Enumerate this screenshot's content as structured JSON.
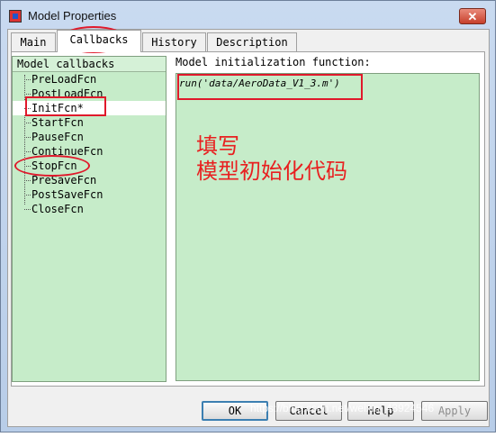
{
  "window": {
    "title": "Model Properties",
    "close_label": "✕"
  },
  "tabs": [
    {
      "label": "Main"
    },
    {
      "label": "Callbacks",
      "active": true
    },
    {
      "label": "History"
    },
    {
      "label": "Description"
    }
  ],
  "callbacks": {
    "header": "Model callbacks",
    "items": [
      "PreLoadFcn",
      "PostLoadFcn",
      "InitFcn*",
      "StartFcn",
      "PauseFcn",
      "ContinueFcn",
      "StopFcn",
      "PreSaveFcn",
      "PostSaveFcn",
      "CloseFcn"
    ],
    "selected": "InitFcn*"
  },
  "editor": {
    "label": "Model initialization function:",
    "code": "run('data/AeroData_V1_3.m')"
  },
  "annotation": {
    "line1": "填写",
    "line2": "模型初始化代码",
    "color": "#e82020"
  },
  "buttons": {
    "ok": "OK",
    "cancel": "Cancel",
    "help": "Help",
    "apply": "Apply"
  },
  "watermark": "https://blog.csdn.net/weixin_43924546"
}
